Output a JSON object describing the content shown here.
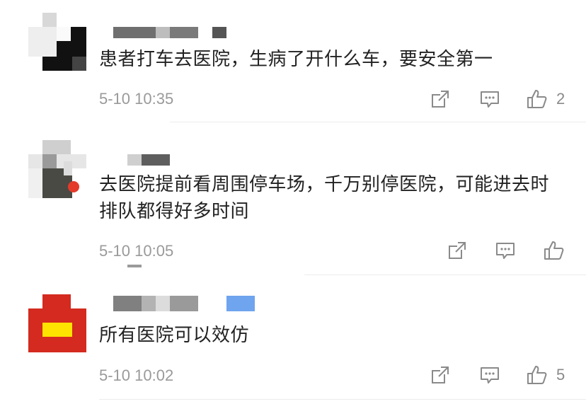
{
  "comments": [
    {
      "text": "患者打车去医院，生病了开什么车，要安全第一",
      "time": "5-10 10:35",
      "likes": "2",
      "icons": [
        "share-icon",
        "comment-icon",
        "thumbs-up-icon"
      ]
    },
    {
      "text": "去医院提前看周围停车场，千万别停医院，可能进去时排队都得好多时间",
      "time": "5-10 10:05",
      "likes": "",
      "icons": [
        "share-icon",
        "comment-icon",
        "thumbs-up-icon"
      ]
    },
    {
      "text": "所有医院可以效仿",
      "time": "5-10 10:02",
      "likes": "5",
      "icons": [
        "share-icon",
        "comment-icon",
        "thumbs-up-icon"
      ]
    }
  ],
  "colors": {
    "text": "#222222",
    "meta": "#9a9a9a",
    "icon": "#8a8a8a",
    "divider": "#ececec"
  }
}
